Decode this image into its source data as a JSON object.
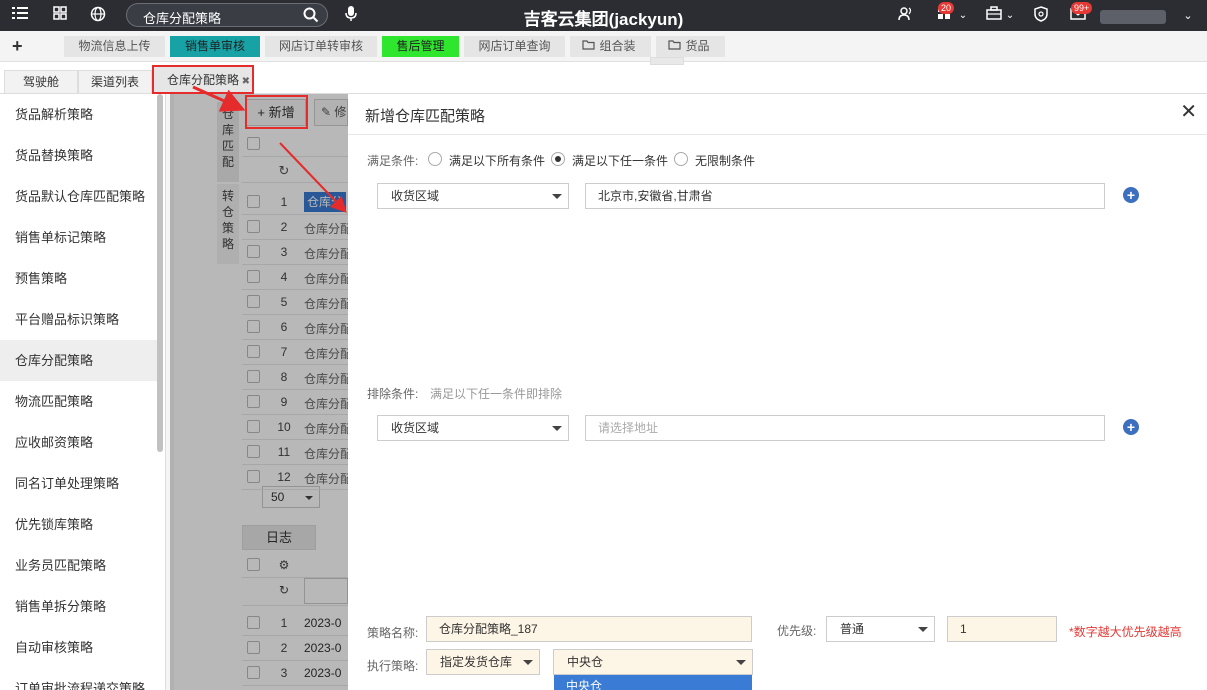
{
  "topbar": {
    "search_text": "仓库分配策略",
    "brand": "吉客云集团(jackyun)",
    "badge_tasks": "20",
    "badge_messages": "99+"
  },
  "quickbar": {
    "tabs": [
      "物流信息上传",
      "销售单审核",
      "网店订单转审核",
      "售后管理",
      "网店订单查询",
      "组合装",
      "货品"
    ]
  },
  "pagetabs": [
    "驾驶舱",
    "渠道列表",
    "仓库分配策略"
  ],
  "sidebar": {
    "items": [
      "货品解析策略",
      "货品替换策略",
      "货品默认仓库匹配策略",
      "销售单标记策略",
      "预售策略",
      "平台赠品标识策略",
      "仓库分配策略",
      "物流匹配策略",
      "应收邮资策略",
      "同名订单处理策略",
      "优先锁库策略",
      "业务员匹配策略",
      "销售单拆分策略",
      "自动审核策略",
      "订单审批流程递交策略"
    ],
    "active_index": 6
  },
  "list": {
    "new_button": "+ 新增",
    "edit_button": "修",
    "vtab1": "仓库匹配",
    "vtab2": "转仓策略",
    "rows": [
      {
        "num": "1",
        "text": "仓库分"
      },
      {
        "num": "2",
        "text": "仓库分配"
      },
      {
        "num": "3",
        "text": "仓库分配"
      },
      {
        "num": "4",
        "text": "仓库分配"
      },
      {
        "num": "5",
        "text": "仓库分配"
      },
      {
        "num": "6",
        "text": "仓库分配"
      },
      {
        "num": "7",
        "text": "仓库分配"
      },
      {
        "num": "8",
        "text": "仓库分配"
      },
      {
        "num": "9",
        "text": "仓库分配"
      },
      {
        "num": "10",
        "text": "仓库分配"
      },
      {
        "num": "11",
        "text": "仓库分配"
      },
      {
        "num": "12",
        "text": "仓库分配"
      }
    ],
    "page_size": "50",
    "log_tab": "日志",
    "log_rows": [
      {
        "num": "1",
        "text": "2023-0"
      },
      {
        "num": "2",
        "text": "2023-0"
      },
      {
        "num": "3",
        "text": "2023-0"
      }
    ]
  },
  "modal": {
    "title": "新增仓库匹配策略",
    "satisfy_label": "满足条件:",
    "radio_options": [
      "满足以下所有条件",
      "满足以下任一条件",
      "无限制条件"
    ],
    "radio_selected": 1,
    "cond_field": "收货区域",
    "cond_value": "北京市,安徽省,甘肃省",
    "exclude_label": "排除条件:",
    "exclude_hint": "满足以下任一条件即排除",
    "exclude_field": "收货区域",
    "exclude_placeholder": "请选择地址",
    "name_label": "策略名称:",
    "name_value": "仓库分配策略_187",
    "priority_label": "优先级:",
    "priority_value": "普通",
    "priority_num": "1",
    "priority_hint": "*数字越大优先级越高",
    "exec_label": "执行策略:",
    "exec_value": "指定发货仓库",
    "warehouse_value": "中央仓",
    "dropdown_option": "中央仓"
  },
  "colors": {
    "topbar": "#2b2d33",
    "accent_red": "#e52b2b",
    "select_blue": "#3a7bd5",
    "teal_tab": "#17a2a6",
    "green_tab": "#2ee62e"
  }
}
